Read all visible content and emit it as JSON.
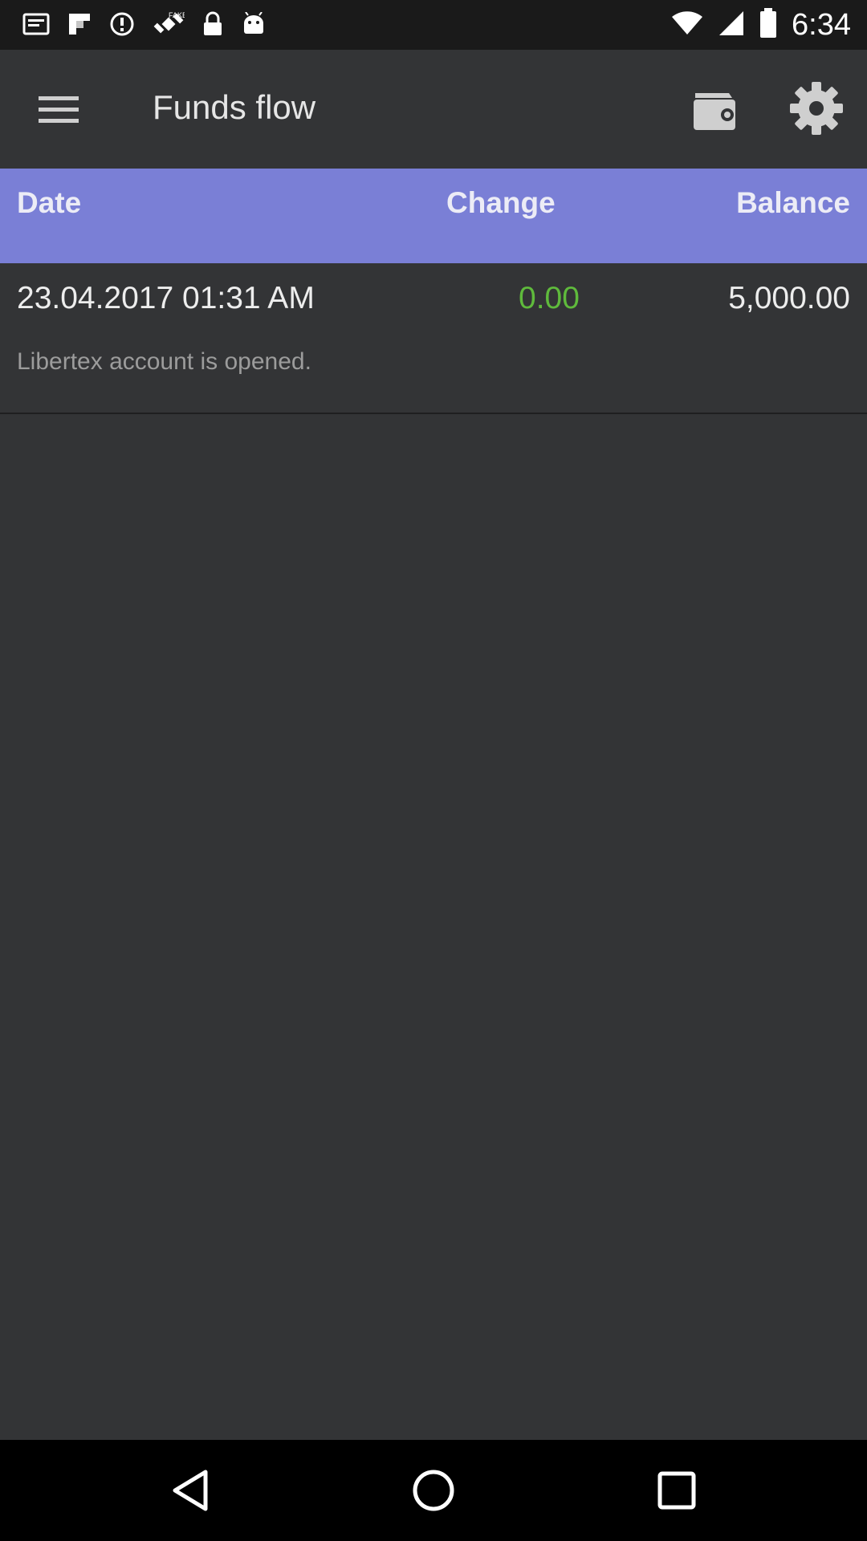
{
  "status_bar": {
    "time": "6:34",
    "icons": [
      "notification-icon",
      "flipboard-icon",
      "alert-icon",
      "satellite-icon",
      "lock-icon",
      "android-icon",
      "wifi-icon",
      "signal-icon",
      "battery-icon"
    ]
  },
  "app_bar": {
    "title": "Funds flow",
    "icons": [
      "menu-icon",
      "wallet-icon",
      "gear-icon"
    ]
  },
  "table": {
    "headers": {
      "date": "Date",
      "change": "Change",
      "balance": "Balance"
    },
    "rows": [
      {
        "date": "23.04.2017 01:31 AM",
        "change": "0.00",
        "balance": "5,000.00",
        "description": "Libertex account is opened."
      }
    ]
  },
  "nav_bar": {
    "icons": [
      "back-icon",
      "home-icon",
      "recents-icon"
    ]
  },
  "colors": {
    "background": "#333436",
    "header_accent": "#7a7fd6",
    "change_positive": "#5fba3c"
  }
}
